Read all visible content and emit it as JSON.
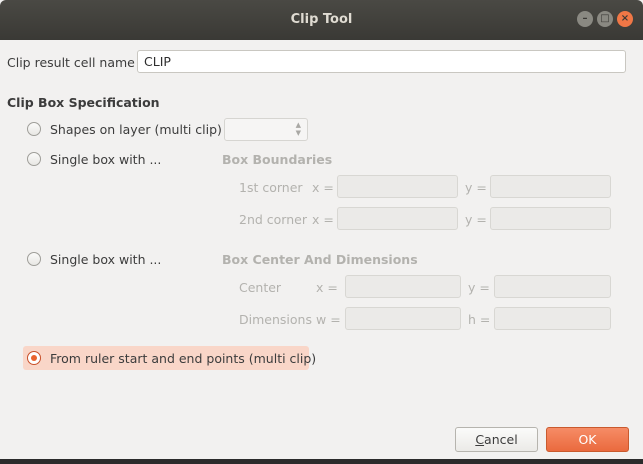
{
  "window": {
    "title": "Clip Tool",
    "controls": {
      "minimize": "–",
      "maximize": "□",
      "close": "×"
    }
  },
  "cell_name": {
    "label": "Clip result cell name",
    "value": "CLIP"
  },
  "spec": {
    "heading": "Clip Box Specification",
    "option_shapes": "Shapes on layer (multi clip)",
    "option_box_boundaries": "Single box with ...",
    "option_box_center": "Single box with ...",
    "option_ruler": "From ruler start and end points (multi clip)",
    "selected": "option_ruler"
  },
  "boundaries": {
    "heading": "Box Boundaries",
    "corner1": "1st corner",
    "corner2": "2nd corner",
    "x_label": "x =",
    "y_label": "y ="
  },
  "center": {
    "heading": "Box Center And Dimensions",
    "center_label": "Center",
    "dimensions_label": "Dimensions",
    "x_label": "x =",
    "y_label": "y =",
    "w_label": "w =",
    "h_label": "h ="
  },
  "buttons": {
    "cancel_first": "C",
    "cancel_rest": "ancel",
    "ok": "OK"
  },
  "colors": {
    "accent": "#e9642f",
    "titlebar": "#3a3935"
  }
}
